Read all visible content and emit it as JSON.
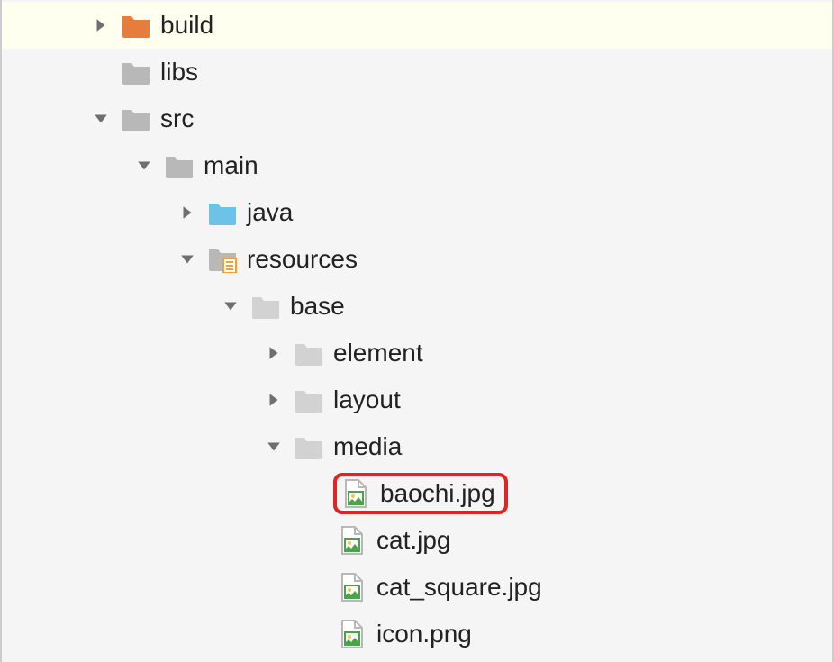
{
  "tree": {
    "build": "build",
    "libs": "libs",
    "src": "src",
    "main": "main",
    "java": "java",
    "resources": "resources",
    "base": "base",
    "element": "element",
    "layout": "layout",
    "media": "media",
    "baochi": "baochi.jpg",
    "cat": "cat.jpg",
    "cat_square": "cat_square.jpg",
    "icon_png": "icon.png"
  }
}
